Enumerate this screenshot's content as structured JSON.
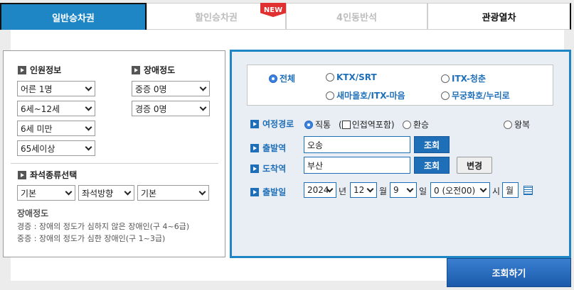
{
  "tabs": [
    {
      "label": "일반승차권"
    },
    {
      "label": "할인승차권"
    },
    {
      "label": "4인동반석"
    },
    {
      "label": "관광열차"
    }
  ],
  "new_badge": "NEW",
  "passengers": {
    "title": "인원정보",
    "adult": "어른 1명",
    "child": "6세~12세",
    "infant": "6세 미만",
    "senior": "65세이상"
  },
  "disability": {
    "title": "장애정도",
    "severe": "중증 0명",
    "mild": "경증 0명"
  },
  "seat_type": {
    "title": "좌석종류선택",
    "opt1": "기본",
    "opt2": "좌석방향",
    "opt3": "기본"
  },
  "disability_notes": {
    "title": "장애정도",
    "mild": "경증 : 장애의 정도가 심하지 않은 장애인(구 4~6급)",
    "severe": "중증 : 장애의 정도가 심한 장애인(구 1~3급)"
  },
  "train_types": {
    "all": "전체",
    "ktx": "KTX/SRT",
    "itx_cheongchun": "ITX-청춘",
    "saemaeul": "새마을호/ITX-마음",
    "mugunghwa": "무궁화호/누리로"
  },
  "route": {
    "label": "여정경로",
    "direct": "직통",
    "transfer_station": "인접역포함",
    "transfer": "환승",
    "round_trip": "왕복"
  },
  "departure": {
    "label": "출발역",
    "value": "오송",
    "search_btn": "조회"
  },
  "arrival": {
    "label": "도착역",
    "value": "부산",
    "search_btn": "조회",
    "swap_btn": "변경"
  },
  "date": {
    "label": "출발일",
    "year": "2024",
    "year_unit": "년",
    "month": "12",
    "month_unit": "월",
    "day": "9",
    "day_unit": "일",
    "hour": "0 (오전00)",
    "hour_unit": "시",
    "weekday": "월"
  },
  "search_button": "조회하기"
}
